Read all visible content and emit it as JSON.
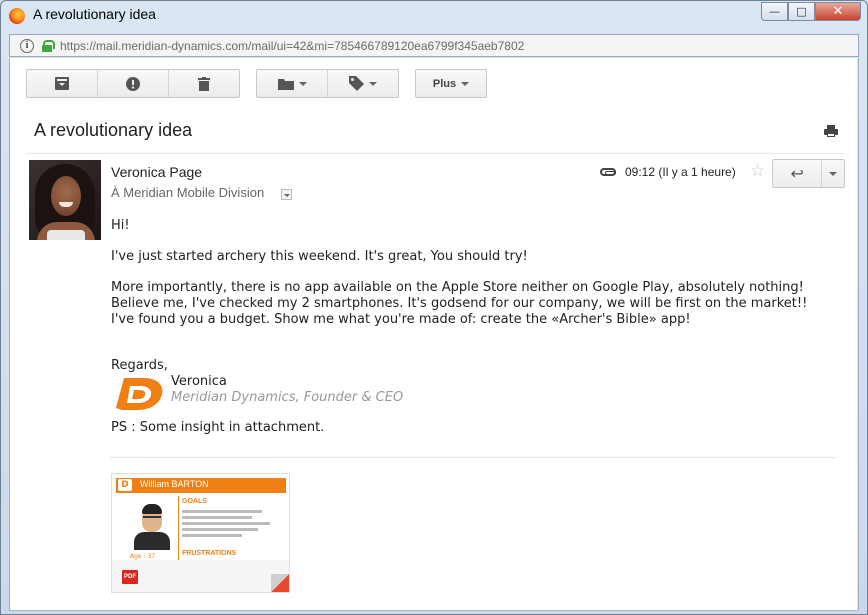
{
  "window": {
    "title": "A revolutionary idea",
    "minimize_glyph": "—",
    "maximize_glyph": "□",
    "close_glyph": "✕"
  },
  "address_bar": {
    "url": "https://mail.meridian-dynamics.com/mail/ui=42&mi=785466789120ea6799f345aeb7802",
    "info_glyph": "i"
  },
  "toolbar": {
    "archive_icon": "archive-icon",
    "spam_icon": "report-spam-icon",
    "delete_icon": "trash-icon",
    "move_icon": "folder-icon",
    "labels_icon": "tag-icon",
    "more_label": "Plus"
  },
  "message": {
    "subject": "A revolutionary idea",
    "sender": "Veronica Page",
    "recipient": "À Meridian Mobile Division",
    "time": "09:12 (Il y a 1 heure)",
    "star_glyph": "☆",
    "reply_glyph": "↩",
    "greeting": "Hi!",
    "paragraph1": "I've just started archery this weekend. It's great, You should try!",
    "paragraph2_lines": [
      "More importantly, there is no app available on the Apple Store neither on Google Play, absolutely nothing!",
      "Believe me, I've checked my 2 smartphones. It's godsend for our company, we will be first on the market!!",
      "I've found you a budget. Show me what you're made of: create the «Archer's Bible» app!"
    ],
    "regards": "Regards,",
    "signature_name": "Veronica",
    "signature_title": "Meridian Dynamics, Founder & CEO",
    "ps": "PS : Some insight in attachment."
  },
  "attachment": {
    "header_name": "William BARTON",
    "logo_letter": "D",
    "goals_label": "GOALS",
    "frustrations_label": "FRUSTRATIONS",
    "age_label": "Age : 37",
    "file_type": "PDF"
  },
  "colors": {
    "brand_orange": "#f08014",
    "pdf_red": "#d8281c",
    "lock_green": "#3ba93b"
  }
}
